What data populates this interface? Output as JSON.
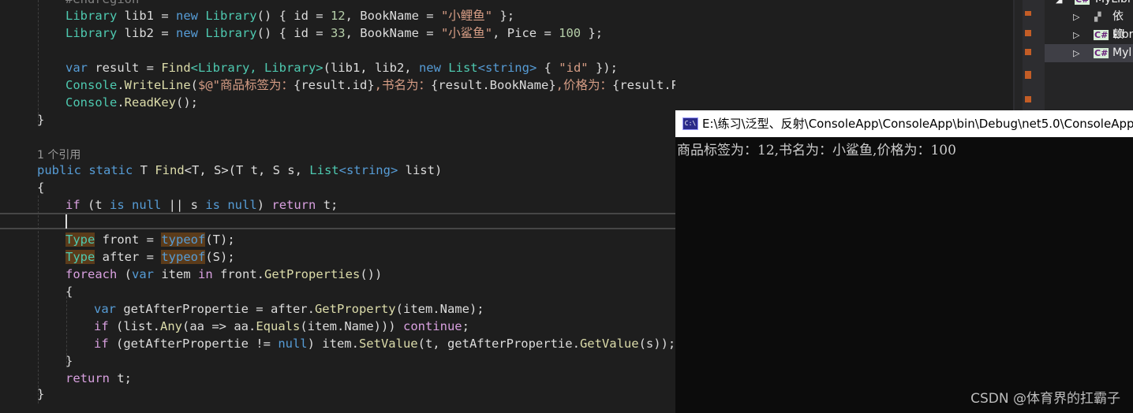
{
  "editor": {
    "lines": {
      "l0": "#endregion",
      "l1_type": "Library",
      "l1_var": " lib1 = ",
      "l1_new": "new",
      "l1_ctor": " Library",
      "l1_a": "() { id = ",
      "l1_num": "12",
      "l1_b": ", BookName = ",
      "l1_str": "\"小鲤鱼\"",
      "l1_c": " };",
      "l2_type": "Library",
      "l2_var": " lib2 = ",
      "l2_new": "new",
      "l2_ctor": " Library",
      "l2_a": "() { id = ",
      "l2_num": "33",
      "l2_b": ", BookName = ",
      "l2_str": "\"小鲨鱼\"",
      "l2_c": ", Pice = ",
      "l2_num2": "100",
      "l2_d": " };",
      "l4_var": "var",
      "l4_a": " result = ",
      "l4_fn": "Find",
      "l4_g1": "<Library, Library>",
      "l4_b": "(lib1, lib2, ",
      "l4_new": "new",
      "l4_list": " List",
      "l4_g2": "<string>",
      "l4_c": " { ",
      "l4_str": "\"id\"",
      "l4_d": " });",
      "l5_type": "Console",
      "l5_a": ".",
      "l5_fn": "WriteLine",
      "l5_b": "(",
      "l5_str1": "$@\"商品标签为：",
      "l5_i1": "{result.id}",
      "l5_str2": ",书名为：",
      "l5_i2": "{result.BookName}",
      "l5_str3": ",价格为：",
      "l5_i3": "{result.Pice}",
      "l5_str4": "\"",
      "l5_c": ");",
      "l6_type": "Console",
      "l6_a": ".",
      "l6_fn": "ReadKey",
      "l6_b": "();",
      "l7": "}",
      "l9_ref": "1 个引用",
      "l10_pub": "public",
      "l10_static": " static",
      "l10_a": " T ",
      "l10_fn": "Find",
      "l10_b": "<T, S>(T t, S s, ",
      "l10_list": "List",
      "l10_g": "<string>",
      "l10_c": " list)",
      "l11": "{",
      "l12_if": "if",
      "l12_a": " (t ",
      "l12_is": "is",
      "l12_null": " null",
      "l12_b": " || s ",
      "l12_is2": "is",
      "l12_null2": " null",
      "l12_c": ") ",
      "l12_ret": "return",
      "l12_d": " t;",
      "l14_type": "Type",
      "l14_a": " front = ",
      "l14_typeof": "typeof",
      "l14_b": "(T);",
      "l15_type": "Type",
      "l15_a": " after = ",
      "l15_typeof": "typeof",
      "l15_b": "(S);",
      "l16_foreach": "foreach",
      "l16_a": " (",
      "l16_var": "var",
      "l16_b": " item ",
      "l16_in": "in",
      "l16_c": " front.",
      "l16_fn": "GetProperties",
      "l16_d": "())",
      "l17": "{",
      "l18_var": "var",
      "l18_a": " getAfterPropertie = after.",
      "l18_fn": "GetProperty",
      "l18_b": "(item.Name);",
      "l19_if": "if",
      "l19_a": " (list.",
      "l19_fn": "Any",
      "l19_b": "(aa => aa.",
      "l19_fn2": "Equals",
      "l19_c": "(item.Name))) ",
      "l19_cont": "continue",
      "l19_d": ";",
      "l20_if": "if",
      "l20_a": " (getAfterPropertie != ",
      "l20_null": "null",
      "l20_b": ") item.",
      "l20_fn": "SetValue",
      "l20_c": "(t, getAfterPropertie.",
      "l20_fn2": "GetValue",
      "l20_d": "(s));",
      "l21": "}",
      "l22_ret": "return",
      "l22_a": " t;",
      "l23": "}"
    }
  },
  "solution_explorer": {
    "items": [
      "MyLibr",
      "依赖",
      "Libr",
      "Myl"
    ]
  },
  "console": {
    "title": "E:\\练习\\泛型、反射\\ConsoleApp\\ConsoleApp\\bin\\Debug\\net5.0\\ConsoleApp",
    "icon_label": "C:\\",
    "output": "商品标签为：12,书名为：小鲨鱼,价格为：100"
  },
  "watermark": "CSDN @体育界的扛霸子",
  "colors": {
    "editor_bg": "#1e1e1e",
    "keyword": "#569cd6",
    "control_keyword": "#d8a0df",
    "type": "#4ec9b0",
    "method": "#dcdcaa",
    "string": "#d69d85",
    "number": "#b5cea8",
    "console_bg": "#0c0c0c"
  }
}
